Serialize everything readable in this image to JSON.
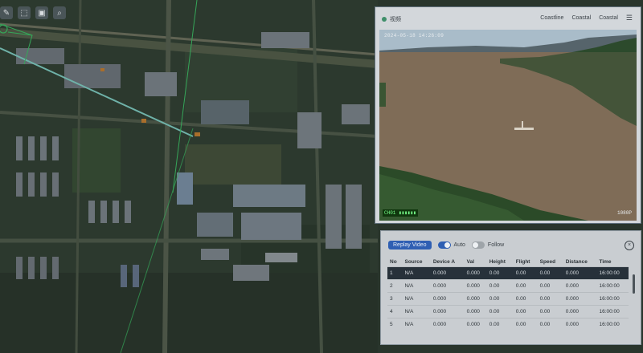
{
  "map": {
    "tools": [
      {
        "icon": "pencil-icon",
        "glyph": "✎"
      },
      {
        "icon": "select-icon",
        "glyph": "⬚"
      },
      {
        "icon": "layers-icon",
        "glyph": "▣"
      },
      {
        "icon": "search-icon",
        "glyph": "⌕"
      }
    ]
  },
  "video": {
    "title": "视频",
    "buttons": [
      "Coastline",
      "Coastal",
      "Coastal"
    ],
    "menu_icon": "☰",
    "osd_time": "2024-05-18 14:26:09",
    "osd_bottom_left": "CH01 ▮▮▮▮▮▮",
    "osd_bottom_right": "1080P"
  },
  "table_panel": {
    "play_label": "Replay Video",
    "toggle1_label": "Auto",
    "toggle2_label": "Follow",
    "close_icon": "×",
    "headers": [
      "No",
      "Source",
      "Device A",
      "Val",
      "Height",
      "Flight",
      "Speed",
      "Distance",
      "Time"
    ],
    "rows": [
      [
        "1",
        "N/A",
        "0.000",
        "0.000",
        "0.00",
        "0.00",
        "0.00",
        "0.000",
        "16:00:00"
      ],
      [
        "2",
        "N/A",
        "0.000",
        "0.000",
        "0.00",
        "0.00",
        "0.00",
        "0.000",
        "16:00:00"
      ],
      [
        "3",
        "N/A",
        "0.000",
        "0.000",
        "0.00",
        "0.00",
        "0.00",
        "0.000",
        "16:00:00"
      ],
      [
        "4",
        "N/A",
        "0.000",
        "0.000",
        "0.00",
        "0.00",
        "0.00",
        "0.000",
        "16:00:00"
      ],
      [
        "5",
        "N/A",
        "0.000",
        "0.000",
        "0.00",
        "0.00",
        "0.00",
        "0.000",
        "16:00:00"
      ]
    ],
    "selected_row": 0
  },
  "colors": {
    "accent": "#2f5fb3",
    "route_green": "#3fd86a",
    "route_cyan": "#8fe8d8",
    "marker_orange": "#e0892a"
  }
}
